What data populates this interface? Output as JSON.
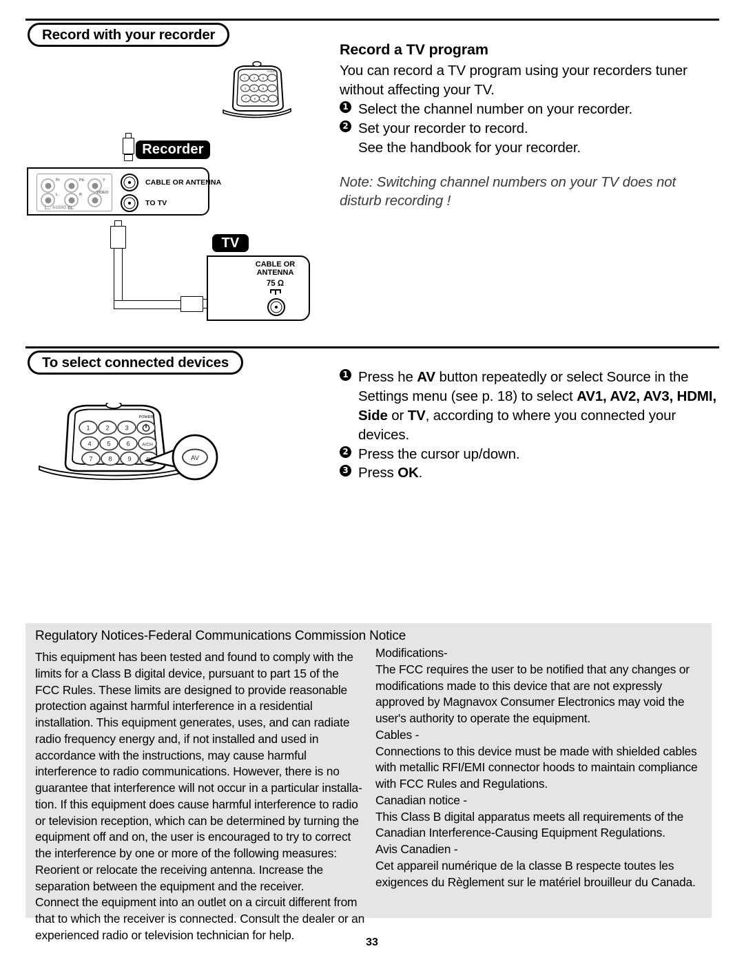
{
  "page": {
    "number": "33"
  },
  "sections": [
    {
      "badge": "Record with your recorder",
      "heading": "Record a TV program",
      "intro": [
        "You can record a TV program using your recorders tuner",
        "without affecting your TV."
      ],
      "steps": [
        {
          "num": "❶",
          "text": "Select the channel number on your recorder."
        },
        {
          "num": "❷",
          "text": "Set your recorder to record."
        }
      ],
      "extra_line": "See the handbook for your recorder.",
      "note": "Note: Switching channel numbers on your TV does not disturb recording !"
    },
    {
      "badge": "To select connected devices",
      "steps": [
        {
          "num": "❶",
          "line1_a": "Press he ",
          "line1_b": "AV",
          "line1_c": " button repeatedly or select Source in the",
          "line2_a": "Settings menu (see p. 18) to select ",
          "line2_b": "AV1, AV2, AV3, HDMI, Side",
          "line3_a": "or ",
          "line3_b": "TV",
          "line3_c": ", according to where you connected your devices."
        },
        {
          "num": "❷",
          "text": "Press the cursor up/down."
        },
        {
          "num": "❸",
          "text_a": "Press ",
          "text_b": "OK",
          "text_c": "."
        }
      ]
    }
  ],
  "diagram": {
    "recorder_badge": "Recorder",
    "tv_badge": "TV",
    "recorder_jacks": [
      {
        "label": "CABLE OR ANTENNA"
      },
      {
        "label": "TO TV"
      }
    ],
    "rca_labels_top": [
      "Pr",
      "Pb",
      "Y"
    ],
    "rca_labels_bottom": [
      "L",
      "R",
      "VIDEO"
    ],
    "audio_in": "AUDIO IN",
    "tv_jack_label_line1": "CABLE OR",
    "tv_jack_label_line2": "ANTENNA",
    "tv_impedance": "75 Ω"
  },
  "remote": {
    "power_label": "POWER",
    "keys": [
      "1",
      "2",
      "3",
      "⏻",
      "4",
      "5",
      "6",
      "A/CH",
      "7",
      "8",
      "9",
      "AV"
    ],
    "callout_key": "AV"
  },
  "fcc": {
    "title": "Regulatory Notices-Federal Communications Commission Notice",
    "left_column": [
      "This equipment has been tested and found to comply with the limits for a Class B digital device, pursuant to part 15 of the FCC Rules. These limits are designed to provide reasonable protection against harmful interference in a residential installation. This equipment generates, uses, and can radiate radio frequency energy and, if not installed and used in accordance with the instructions, may cause harmful interference to radio communications. However, there is no guarantee that interference will not occur in a particular installa-tion. If this equipment does cause harmful interference to radio or television reception, which can be determined by turning the equipment off and on, the user is encouraged to try to correct the interference by one or more of the following measures:",
      "Reorient or relocate the receiving antenna. Increase the separation between the equipment and the receiver.",
      "Connect the equipment into an outlet on a circuit different from that to which the receiver is connected. Consult the dealer or an experienced radio or television technician for help."
    ],
    "right_column": [
      "Modifications-",
      "The FCC requires the user to be notified that any changes or modifications made to this device that are not expressly approved by Magnavox Consumer Electronics may void the user's authority to operate the equipment.",
      "Cables -",
      "Connections to this device must be made with shielded cables with metallic RFI/EMI connector hoods to maintain compliance with FCC Rules and Regulations.",
      "Canadian notice -",
      "This Class B digital apparatus meets all requirements of the Canadian Interference-Causing Equipment Regulations.",
      "Avis Canadien -",
      "Cet appareil numérique de la classe B respecte toutes les exigences du Règlement sur le matériel brouilleur du Canada."
    ]
  }
}
